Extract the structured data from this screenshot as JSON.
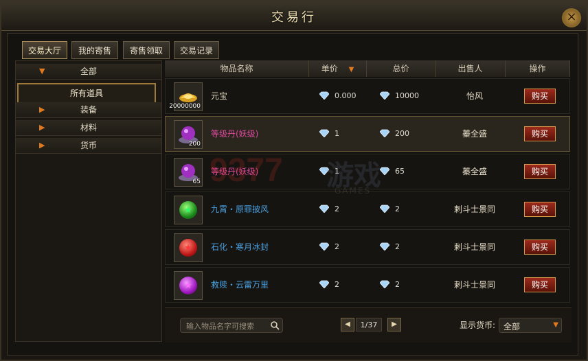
{
  "window": {
    "title": "交易行",
    "close_label": "×"
  },
  "tabs": [
    {
      "label": "交易大厅",
      "active": true
    },
    {
      "label": "我的寄售",
      "active": false
    },
    {
      "label": "寄售领取",
      "active": false
    },
    {
      "label": "交易记录",
      "active": false
    }
  ],
  "sidebar": {
    "all_label": "全部",
    "selected_label": "所有道具",
    "items": [
      {
        "label": "装备"
      },
      {
        "label": "材料"
      },
      {
        "label": "货币"
      }
    ]
  },
  "table": {
    "headers": {
      "name": "物品名称",
      "unit_price": "单价",
      "total": "总价",
      "seller": "出售人",
      "action": "操作"
    },
    "rows": [
      {
        "name": "元宝",
        "qty": "20000000",
        "unit_price": "0.000",
        "total": "10000",
        "seller": "怡风",
        "buy": "购买",
        "name_color": "#e5dcc8",
        "icon": "gold-ingot-icon"
      },
      {
        "name": "等级丹(妖级)",
        "qty": "200",
        "unit_price": "1",
        "total": "200",
        "seller": "蓁全盛",
        "buy": "购买",
        "name_color": "#e04aa0",
        "icon": "pill-icon"
      },
      {
        "name": "等级丹(妖级)",
        "qty": "65",
        "unit_price": "1",
        "total": "65",
        "seller": "蓁全盛",
        "buy": "购买",
        "name_color": "#e04aa0",
        "icon": "pill-icon"
      },
      {
        "name": "九霄・原罪披风",
        "qty": "",
        "unit_price": "2",
        "total": "2",
        "seller": "剌斗士景同",
        "buy": "购买",
        "name_color": "#4aa0e0",
        "icon": "green-gem-icon"
      },
      {
        "name": "石化・寒月冰封",
        "qty": "",
        "unit_price": "2",
        "total": "2",
        "seller": "剌斗士景同",
        "buy": "购买",
        "name_color": "#4aa0e0",
        "icon": "red-gem-icon"
      },
      {
        "name": "救赎・云雷万里",
        "qty": "",
        "unit_price": "2",
        "total": "2",
        "seller": "剌斗士景同",
        "buy": "购买",
        "name_color": "#4aa0e0",
        "icon": "purple-gem-icon"
      }
    ]
  },
  "search": {
    "placeholder": "输入物品名字可搜索"
  },
  "pager": {
    "page": "1/37"
  },
  "currency": {
    "label": "显示货币:",
    "value": "全部"
  },
  "watermark": {
    "main": "9377",
    "sub": "游戏",
    "small": "GAMES"
  }
}
